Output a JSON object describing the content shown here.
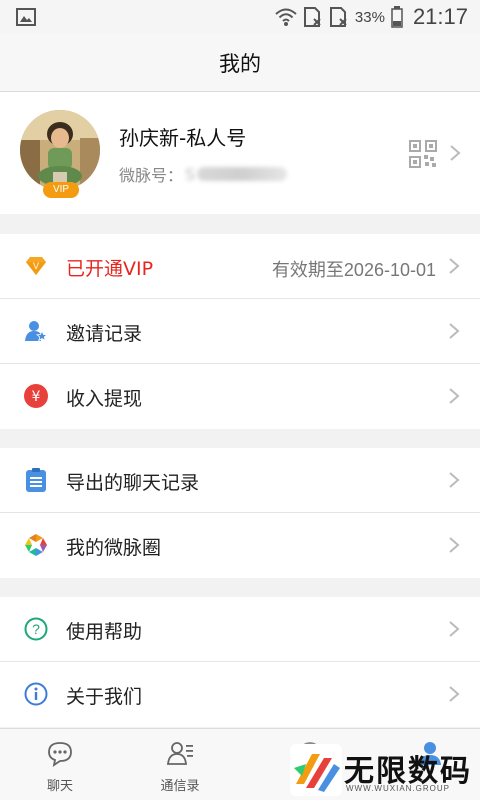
{
  "status_bar": {
    "battery": "33%",
    "time": "21:17"
  },
  "header": {
    "title": "我的"
  },
  "profile": {
    "name": "孙庆新-私人号",
    "id_label": "微脉号：",
    "id_value": "S",
    "vip_badge": "VIP"
  },
  "groups": [
    {
      "items": [
        {
          "label": "已开通VIP",
          "value": "有效期至2026-10-01",
          "icon": "vip-diamond-icon",
          "highlight": "#e8251f"
        },
        {
          "label": "邀请记录",
          "icon": "invite-person-icon"
        },
        {
          "label": "收入提现",
          "icon": "yuan-coin-icon"
        }
      ]
    },
    {
      "items": [
        {
          "label": "导出的聊天记录",
          "icon": "document-list-icon"
        },
        {
          "label": "我的微脉圈",
          "icon": "aperture-icon"
        }
      ]
    },
    {
      "items": [
        {
          "label": "使用帮助",
          "icon": "help-circle-icon"
        },
        {
          "label": "关于我们",
          "icon": "info-circle-icon"
        }
      ]
    }
  ],
  "tabbar": {
    "tabs": [
      {
        "label": "聊天",
        "icon": "chat-bubble-icon"
      },
      {
        "label": "通信录",
        "icon": "contacts-icon"
      }
    ]
  },
  "watermark": {
    "text": "无限数码",
    "sub": "WWW.WUXIAN.GROUP"
  },
  "colors": {
    "vip_red": "#e8251f",
    "vip_orange": "#f39c12",
    "accent_blue": "#4a90e2",
    "help_green": "#1aa77a",
    "info_blue": "#3b7dd8"
  }
}
